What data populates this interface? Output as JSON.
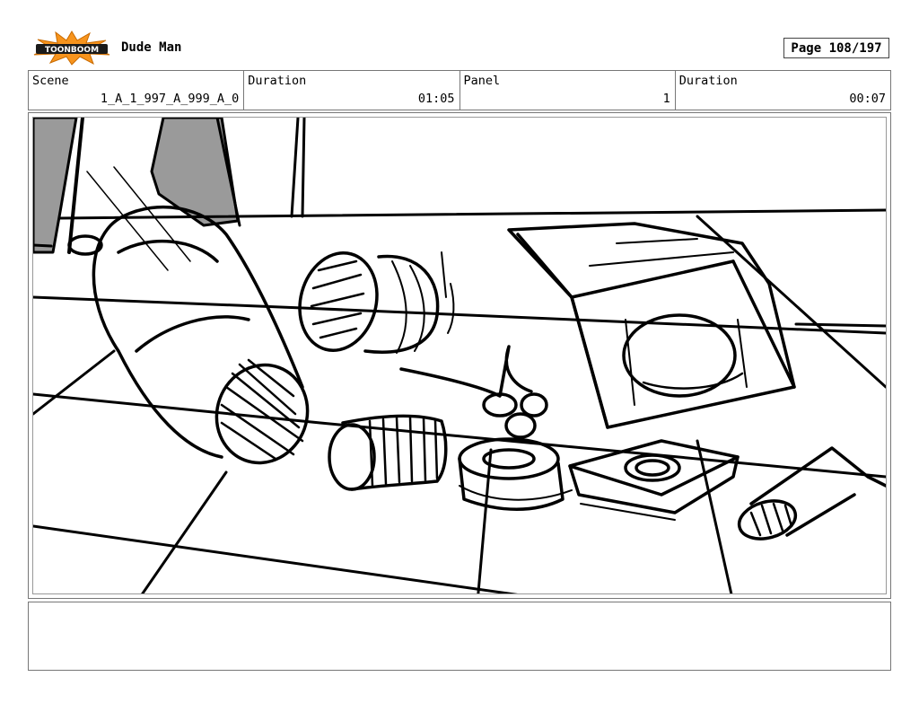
{
  "header": {
    "logo_text": "TOONBOOM",
    "project_title": "Dude Man",
    "page_label": "Page 108/197"
  },
  "info": {
    "scene_label": "Scene",
    "scene_value": "1_A_1_997_A_999_A_0",
    "scene_duration_label": "Duration",
    "scene_duration_value": "01:05",
    "panel_label": "Panel",
    "panel_value": "1",
    "panel_duration_label": "Duration",
    "panel_duration_value": "00:07"
  },
  "colors": {
    "logo_burst": "#f7941d",
    "logo_text_bg": "#1a1a1a",
    "sketch_shadow": "#9a9a9a",
    "ink": "#000000"
  },
  "notes": {
    "text": ""
  }
}
